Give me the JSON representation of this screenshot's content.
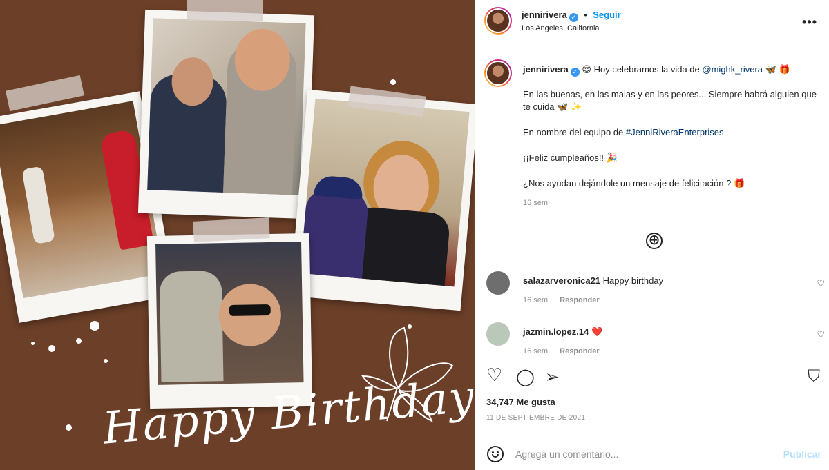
{
  "post_image": {
    "script_text": "Happy Birthday!"
  },
  "header": {
    "username": "jennirivera",
    "verified_mark": "✓",
    "separator": "•",
    "follow_label": "Seguir",
    "location": "Los Angeles, California",
    "more_icon": "more-dots-icon"
  },
  "caption": {
    "username": "jennirivera",
    "line1_emoji": "😍",
    "line1_text": "Hoy celebramos la vida de",
    "mention": "@mighk_rivera",
    "line1_tail": "🦋 🎁",
    "para2": "En las buenas, en las malas y en las peores... Siempre habrá alguien que te cuida 🦋 ✨",
    "para3_text": "En nombre del equipo de",
    "hashtag": "#JenniRiveraEnterprises",
    "para4": "¡¡Feliz cumpleaños!! 🎉",
    "para5": "¿Nos ayudan dejándole un mensaje de felicitación ? 🎁",
    "time": "16 sem"
  },
  "load_more": "⊕",
  "comments": [
    {
      "username": "salazarveronica21",
      "text": "Happy birthday",
      "time": "16 sem",
      "reply": "Responder",
      "avatar_color": "#6e6e6e"
    },
    {
      "username": "jazmin.lopez.14",
      "text": "❤️",
      "time": "16 sem",
      "reply": "Responder",
      "avatar_color": "#b9c8b8"
    }
  ],
  "actions": {
    "like_icon": "♡",
    "comment_icon": "◯",
    "share_icon": "➢",
    "save_icon": "⛉",
    "likes": "34,747 Me gusta",
    "date": "11 DE SEPTIEMBRE DE 2021"
  },
  "add_comment": {
    "placeholder": "Agrega un comentario...",
    "publish_label": "Publicar"
  },
  "colors": {
    "background": "#6b3f28",
    "link": "#0095f6",
    "publish_disabled": "#b2dffc"
  }
}
